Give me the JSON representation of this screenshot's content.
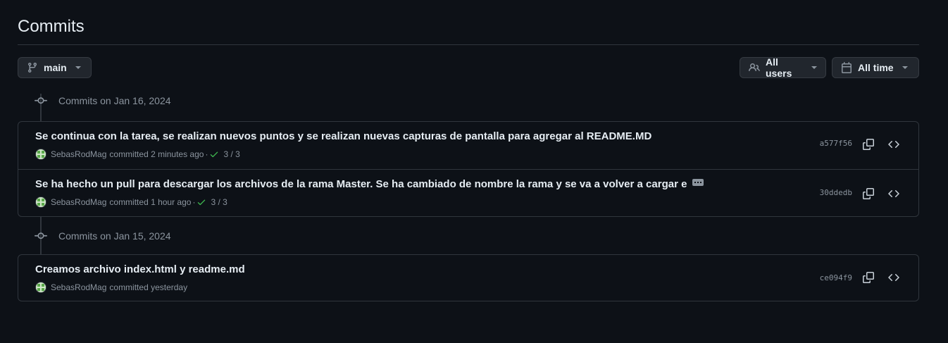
{
  "header": {
    "title": "Commits"
  },
  "filters": {
    "branch_label": "main",
    "users_label": "All users",
    "time_label": "All time"
  },
  "groups": [
    {
      "date_label": "Commits on Jan 16, 2024",
      "commits": [
        {
          "message": "Se continua con la tarea, se realizan nuevos puntos y se realizan nuevas capturas de pantalla para agregar al README.MD",
          "author": "SebasRodMag",
          "committed_text": "committed 2 minutes ago",
          "separator": "·",
          "checks": "3 / 3",
          "sha": "a577f56"
        },
        {
          "message": "Se ha hecho un pull para descargar los archivos de la rama Master. Se ha cambiado de nombre la rama y se va a volver a cargar e",
          "author": "SebasRodMag",
          "committed_text": "committed 1 hour ago",
          "separator": "·",
          "checks": "3 / 3",
          "sha": "30ddedb"
        }
      ]
    },
    {
      "date_label": "Commits on Jan 15, 2024",
      "commits": [
        {
          "message": "Creamos archivo index.html y readme.md",
          "author": "SebasRodMag",
          "committed_text": "committed yesterday",
          "sha": "ce094f9"
        }
      ]
    }
  ],
  "colors": {
    "background": "#0d1117",
    "border": "#30363d",
    "text": "#e6edf3",
    "muted": "#8b949e",
    "success": "#3fb950"
  },
  "icons": {
    "branch": "git-branch-icon",
    "users": "people-icon",
    "time": "calendar-icon",
    "commit": "git-commit-icon",
    "check": "check-icon",
    "copy": "copy-icon",
    "browse": "code-icon",
    "ellipsis": "ellipsis-icon"
  }
}
